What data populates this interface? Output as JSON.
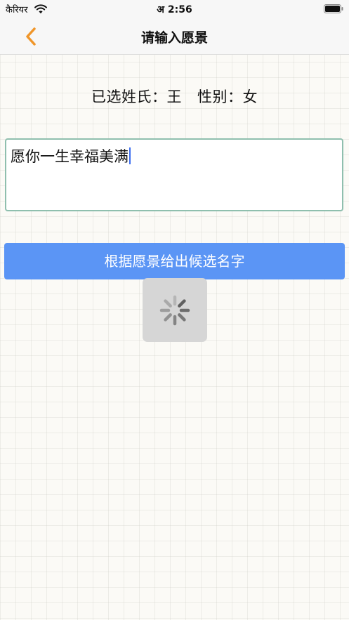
{
  "status_bar": {
    "carrier": "कैरियर",
    "time": "अ 2:56",
    "icons": [
      "wifi-icon",
      "battery-icon"
    ]
  },
  "nav": {
    "back_icon": "chevron-left-icon",
    "title": "请输入愿景"
  },
  "selection": {
    "surname_label": "已选姓氏：",
    "surname": "王",
    "gender_label": "性别：",
    "gender": "女"
  },
  "wish_input": {
    "value": "愿你一生幸福美满"
  },
  "generate_button": {
    "label": "根据愿景给出候选名字"
  },
  "loading": {
    "icon": "activity-spinner-icon"
  },
  "colors": {
    "accent_orange": "#f0962a",
    "button_blue": "#5b95f5",
    "input_border": "#8fbfae",
    "caret_blue": "#3b6df0"
  }
}
